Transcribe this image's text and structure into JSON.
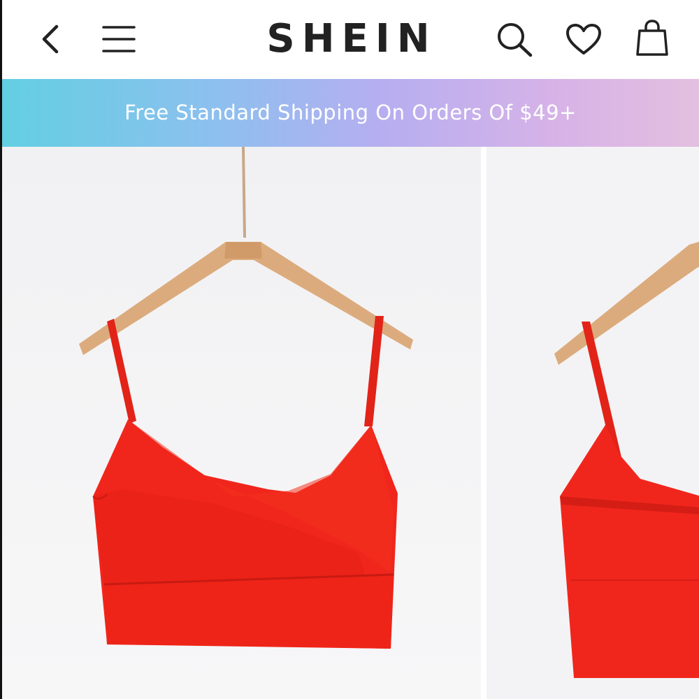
{
  "header": {
    "back_icon": "chevron-left-icon",
    "menu_icon": "hamburger-menu-icon",
    "logo_text": "SHEIN",
    "search_icon": "search-icon",
    "wishlist_icon": "heart-icon",
    "bag_icon": "shopping-bag-icon"
  },
  "promo_banner": {
    "text": "Free Standard Shipping On Orders Of $49+"
  },
  "gallery": {
    "images": [
      {
        "description": "Red cami crop top on wooden hanger, front view"
      },
      {
        "description": "Red cami crop top on wooden hanger, back view (partially visible)"
      }
    ]
  },
  "colors": {
    "product_red": "#f0261c",
    "hanger_wood": "#d9a878",
    "text_dark": "#222222"
  }
}
